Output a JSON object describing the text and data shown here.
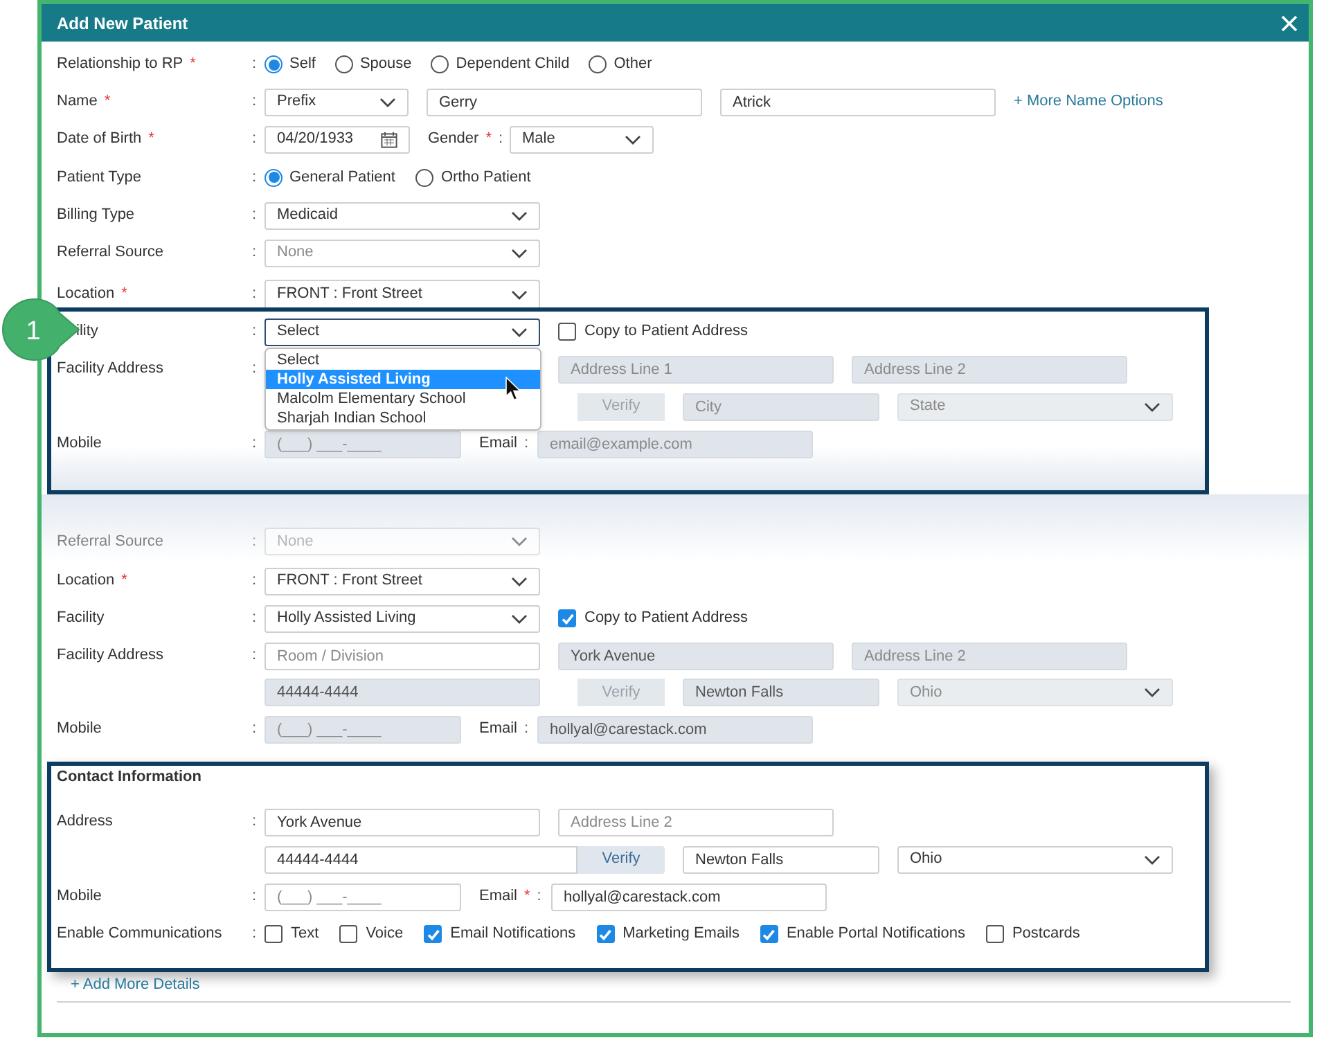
{
  "dialog_title": "Add New Patient",
  "callout_number": "1",
  "top_section": {
    "relationship": {
      "label": "Relationship to RP",
      "required_mark": "*",
      "colon": ":",
      "options": [
        {
          "label": "Self",
          "selected": true
        },
        {
          "label": "Spouse",
          "selected": false
        },
        {
          "label": "Dependent Child",
          "selected": false
        },
        {
          "label": "Other",
          "selected": false
        }
      ]
    },
    "name": {
      "label": "Name",
      "required_mark": "*",
      "colon": ":",
      "prefix": {
        "value": "Prefix"
      },
      "first_name": {
        "value": "Gerry"
      },
      "last_name": {
        "value": "Atrick"
      },
      "link": "+ More Name Options"
    },
    "date_of_birth": {
      "label": "Date of Birth",
      "required_mark": "*",
      "colon": ":",
      "value": "04/20/1933"
    },
    "gender": {
      "label": "Gender",
      "required_mark": "*",
      "colon": ":",
      "value": "Male"
    },
    "patient_type": {
      "label": "Patient Type",
      "colon": ":",
      "options": [
        {
          "label": "General Patient",
          "selected": true
        },
        {
          "label": "Ortho Patient",
          "selected": false
        }
      ]
    },
    "billing_type": {
      "label": "Billing Type",
      "colon": ":",
      "value": "Medicaid"
    },
    "referral_source": {
      "label": "Referral Source",
      "colon": ":",
      "placeholder": "None"
    },
    "location": {
      "label": "Location",
      "required_mark": "*",
      "colon": ":",
      "value": "FRONT : Front Street"
    }
  },
  "highlight_1": {
    "facility": {
      "label": "ility",
      "colon": ":",
      "placeholder": "Select",
      "focused": true
    },
    "copy_to_patient_address": {
      "label": "Copy to Patient Address",
      "checked": false
    },
    "facility_address": {
      "label": "Facility Address",
      "colon": ":",
      "address_line_1": {
        "placeholder": "Address Line 1",
        "disabled": true
      },
      "address_line_2": {
        "placeholder": "Address Line 2",
        "disabled": true
      },
      "verify": {
        "label": "Verify",
        "disabled": true
      },
      "city": {
        "placeholder": "City",
        "disabled": true
      },
      "state": {
        "placeholder": "State",
        "disabled": true
      }
    },
    "mobile": {
      "label": "Mobile",
      "colon": ":",
      "placeholder": "(___) ___-____",
      "disabled": true
    },
    "email": {
      "label": "Email",
      "colon": ":",
      "placeholder": "email@example.com",
      "disabled": true
    },
    "dropdown": [
      {
        "label": "Select",
        "selected": false
      },
      {
        "label": "Holly Assisted Living",
        "selected": true
      },
      {
        "label": "Malcolm Elementary School",
        "selected": false
      },
      {
        "label": "Sharjah Indian School",
        "selected": false
      }
    ]
  },
  "faded_row": {
    "label": "Referral Source",
    "colon": ":",
    "placeholder": "None"
  },
  "middle_section": {
    "location": {
      "label": "Location",
      "required_mark": "*",
      "colon": ":",
      "value": "FRONT : Front Street"
    },
    "facility": {
      "label": "Facility",
      "colon": ":",
      "value": "Holly Assisted Living",
      "focused": false
    },
    "copy_to_patient_address": {
      "label": "Copy to Patient Address",
      "checked": true
    },
    "facility_address": {
      "label": "Facility Address",
      "colon": ":",
      "room_division": {
        "placeholder": "Room / Division",
        "disabled": false
      },
      "address_line_1": {
        "value": "York Avenue",
        "disabled": true
      },
      "address_line_2": {
        "placeholder": "Address Line 2",
        "disabled": true
      },
      "zip": {
        "value": "44444-4444",
        "disabled": true
      },
      "verify": {
        "label": "Verify",
        "disabled": true
      },
      "city": {
        "value": "Newton Falls",
        "disabled": true
      },
      "state": {
        "value": "Ohio",
        "disabled": true
      }
    },
    "mobile": {
      "label": "Mobile",
      "colon": ":",
      "placeholder": "(___) ___-____",
      "disabled": true
    },
    "email": {
      "label": "Email",
      "colon": ":",
      "value": "hollyal@carestack.com",
      "disabled": true
    }
  },
  "contact_information": {
    "heading": "Contact Information",
    "address": {
      "label": "Address",
      "colon": ":",
      "address_line_1": {
        "value": "York Avenue",
        "disabled": false
      },
      "address_line_2": {
        "placeholder": "Address Line 2",
        "disabled": false
      },
      "zip": {
        "value": "44444-4444",
        "disabled": false
      },
      "verify": {
        "label": "Verify",
        "disabled": false
      },
      "city": {
        "value": "Newton Falls",
        "disabled": false
      },
      "state": {
        "value": "Ohio",
        "disabled": false
      }
    },
    "mobile": {
      "label": "Mobile",
      "colon": ":",
      "placeholder": "(___) ___-____",
      "disabled": false
    },
    "email": {
      "label": "Email",
      "required_mark": "*",
      "colon": ":",
      "value": "hollyal@carestack.com",
      "disabled": false
    },
    "enable_communications": {
      "label": "Enable Communications",
      "colon": ":",
      "options": [
        {
          "label": "Text",
          "checked": false
        },
        {
          "label": "Voice",
          "checked": false
        },
        {
          "label": "Email Notifications",
          "checked": true
        },
        {
          "label": "Marketing Emails",
          "checked": true
        },
        {
          "label": "Enable Portal Notifications",
          "checked": true
        },
        {
          "label": "Postcards",
          "checked": false
        }
      ]
    }
  },
  "add_more_details": "+ Add More Details"
}
